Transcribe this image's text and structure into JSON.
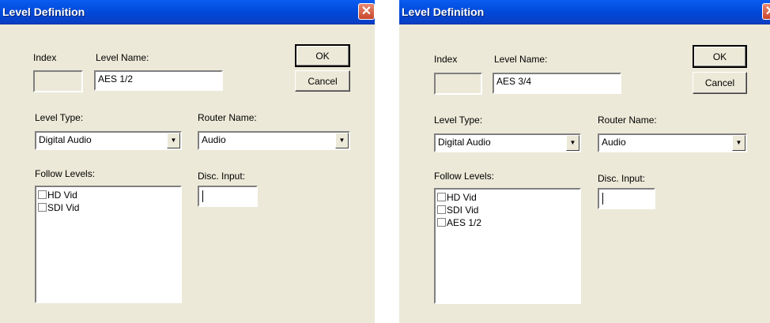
{
  "dialogs": [
    {
      "title": "Level Definition",
      "index_label": "Index",
      "index_value": "",
      "level_name_label": "Level Name:",
      "level_name_value": "AES 1/2",
      "ok_label": "OK",
      "cancel_label": "Cancel",
      "level_type_label": "Level Type:",
      "level_type_value": "Digital Audio",
      "router_name_label": "Router Name:",
      "router_name_value": "Audio",
      "follow_levels_label": "Follow Levels:",
      "follow_levels": [
        {
          "label": "HD Vid",
          "checked": false
        },
        {
          "label": "SDI Vid",
          "checked": false
        }
      ],
      "disc_input_label": "Disc. Input:",
      "disc_input_value": ""
    },
    {
      "title": "Level Definition",
      "index_label": "Index",
      "index_value": "",
      "level_name_label": "Level Name:",
      "level_name_value": "AES 3/4",
      "ok_label": "OK",
      "cancel_label": "Cancel",
      "level_type_label": "Level Type:",
      "level_type_value": "Digital Audio",
      "router_name_label": "Router Name:",
      "router_name_value": "Audio",
      "follow_levels_label": "Follow Levels:",
      "follow_levels": [
        {
          "label": "HD Vid",
          "checked": false
        },
        {
          "label": "SDI Vid",
          "checked": false
        },
        {
          "label": "AES 1/2",
          "checked": false
        }
      ],
      "disc_input_label": "Disc. Input:",
      "disc_input_value": ""
    }
  ],
  "icons": {
    "close": "close-icon",
    "dropdown": "chevron-down-icon",
    "checkbox": "checkbox-icon"
  },
  "colors": {
    "dialog_bg": "#ece9d8",
    "titlebar": "#0054e3",
    "close_button": "#d8573b"
  }
}
